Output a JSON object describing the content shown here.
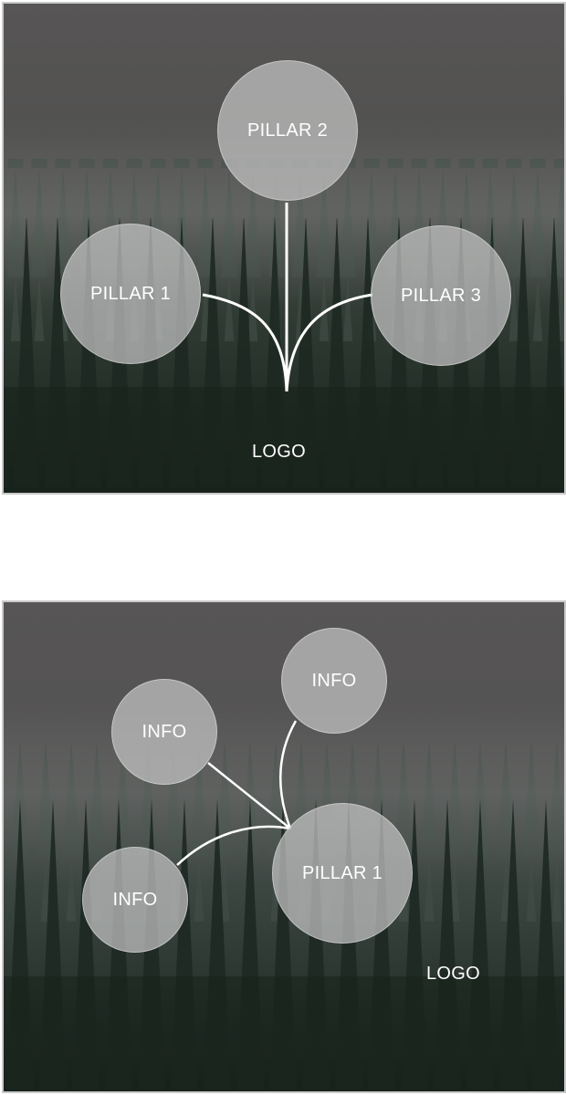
{
  "top_panel": {
    "pillar_1": "PILLAR 1",
    "pillar_2": "PILLAR 2",
    "pillar_3": "PILLAR 3",
    "logo": "LOGO"
  },
  "bottom_panel": {
    "info_top_left": "INFO",
    "info_top_right": "INFO",
    "info_bottom_left": "INFO",
    "pillar_1": "PILLAR 1",
    "logo": "LOGO"
  },
  "colors": {
    "sky": "#5a5858",
    "forest_dark": "#1f2a24",
    "node_fill": "#c4c4c4",
    "connector": "#ffffff",
    "frame": "#c9c9c9"
  }
}
